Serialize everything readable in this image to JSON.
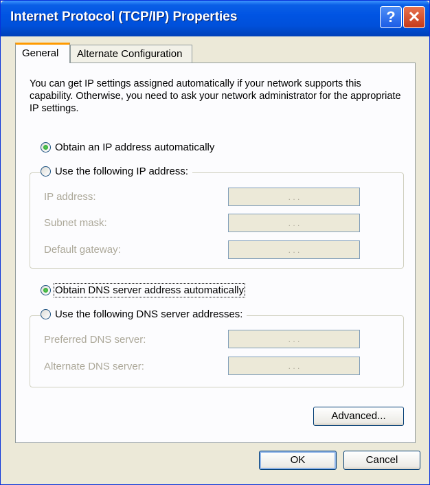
{
  "window": {
    "title": "Internet Protocol (TCP/IP) Properties"
  },
  "titlebar_buttons": {
    "help_label": "?",
    "close_label": "✕"
  },
  "tabs": [
    {
      "label": "General",
      "active": true
    },
    {
      "label": "Alternate Configuration",
      "active": false
    }
  ],
  "intro_text": "You can get IP settings assigned automatically if your network supports this capability. Otherwise, you need to ask your network administrator for the appropriate IP settings.",
  "ip": {
    "auto_label": "Obtain an IP address automatically",
    "manual_label": "Use the following IP address:",
    "selected": "auto",
    "fields": [
      {
        "label": "IP address:",
        "value": ". . ."
      },
      {
        "label": "Subnet mask:",
        "value": ". . ."
      },
      {
        "label": "Default gateway:",
        "value": ". . ."
      }
    ]
  },
  "dns": {
    "auto_label": "Obtain DNS server address automatically",
    "manual_label": "Use the following DNS server addresses:",
    "selected": "auto",
    "fields": [
      {
        "label": "Preferred DNS server:",
        "value": ". . ."
      },
      {
        "label": "Alternate DNS server:",
        "value": ". . ."
      }
    ]
  },
  "buttons": {
    "advanced": "Advanced...",
    "ok": "OK",
    "cancel": "Cancel"
  },
  "colors": {
    "titlebar": "#0054e3",
    "dialog_bg": "#ece9d8",
    "tab_accent": "#ff9a00",
    "radio_selected": "#21a121",
    "disabled_text": "#aca899"
  }
}
